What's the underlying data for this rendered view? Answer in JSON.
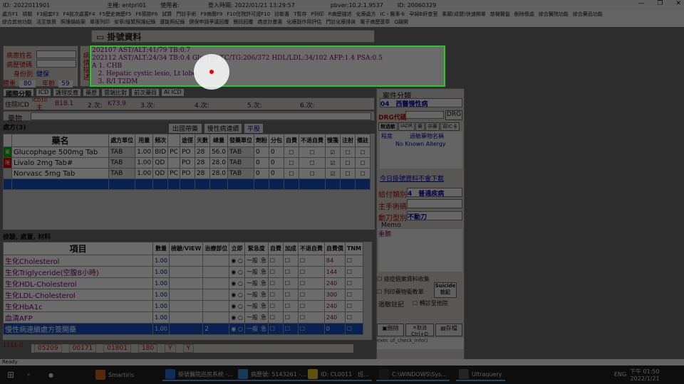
{
  "titlebar": {
    "id_label": "ID:",
    "id_value": "2022011901",
    "host_label": "主機: entpri01",
    "user_label": "使用者:",
    "login_time": "登入時間: 2022/01/21 13:29:57",
    "pbver": "pbver:10.2.1.9537",
    "id2": "ID: 20060329"
  },
  "menu": {
    "row1": [
      "處方F1",
      "檢驗",
      "F3組套F3",
      "F4前次處置F4",
      "F5歷史病歷F5",
      "F6預掛F6",
      "試算",
      "門診手術",
      "F9病曆F9",
      "F10住院許可證F10",
      "診斷書",
      "T暫存",
      "P列印",
      "R病歷描述",
      "化療處方",
      "IC・醫事卡",
      "孕婦B肝查室",
      "素願(成健)快速開單",
      "慈機醫盤",
      "刪除復處",
      "綜合醫院功能",
      "綜合藥品功能"
    ],
    "row2": [
      "綜合其他功能",
      "活至慈資",
      "照護錨結案",
      "單張列印",
      "安寧/緩緊照護紀錄",
      "還能照紀錄",
      "健保申請爭議回覆",
      "簡訊回覆",
      "癌症計畫書",
      "化療副作用評估",
      "門診化療排床",
      "電子病歷簽章",
      "Q離開"
    ]
  },
  "header_tab": "掛號資料",
  "patient": {
    "name_label": "病患姓名",
    "chart_label": "病歷號碼",
    "id_label": "身份別",
    "id_value": "健保",
    "age_label": "年齡",
    "age_value": "59",
    "weight_label": "體重",
    "weight_value": "80"
  },
  "history": {
    "vertical_label": "病情描述",
    "lines": [
      "202107 AST/ALT:41/79 TB:0.7",
      "202112 AST/ALT:24/34 TB:0.4 Glu:129 TC/TG:206/372 HDL/LDL:34/102 AFP:1.4 PSA:0.5",
      "A 1. CHB",
      "   2. Hepatic cystic lesio, Lt lobe",
      "   3. R/I T2DM"
    ]
  },
  "icd": {
    "tabs": [
      "國際分類",
      "ICD",
      "護理反應",
      "藥歷",
      "雲端比對",
      "前次藥目",
      "AI ICD"
    ],
    "main_label": "主",
    "main_code": "B18.1",
    "c2_label": "2.次:",
    "c2_code": "K73.9",
    "c3_label": "3.次:",
    "c4_label": "4.次:",
    "c5_label": "5.次:",
    "c6_label": "6.次:",
    "prefix": "住院ICD",
    "icd10": "ICD10"
  },
  "drug": {
    "label": "藥物"
  },
  "rx": {
    "title": "處方(3)",
    "buttons": [
      "出國帶藥",
      "慢性病連續",
      "平股"
    ],
    "headers": [
      "藥名",
      "處方單位",
      "用量",
      "頻次",
      "",
      "途徑",
      "天數",
      "總量",
      "發藥單位",
      "劑粉",
      "分包",
      "自費",
      "不退自費",
      "慢箋",
      "注射",
      "備註"
    ],
    "rows": [
      {
        "name": "Glucophage 500mg Tab",
        "unit": "TAB",
        "dose": "1.00",
        "freq": "BID",
        "pc": "PC",
        "route": "PO",
        "days": "28",
        "total": "56.0",
        "dunit": "TAB",
        "a": "0",
        "b": "0"
      },
      {
        "name": "Livalo 2mg Tab#",
        "unit": "TAB",
        "dose": "1.00",
        "freq": "QD",
        "pc": "",
        "route": "PO",
        "days": "28",
        "total": "28.0",
        "dunit": "TAB",
        "a": "0",
        "b": "0"
      },
      {
        "name": "Norvasc 5mg Tab",
        "unit": "TAB",
        "dose": "1.00",
        "freq": "QD",
        "pc": "PC",
        "route": "PO",
        "days": "28",
        "total": "28.0",
        "dunit": "TAB",
        "a": "0",
        "b": "0"
      }
    ]
  },
  "side": {
    "case_label": "案件分類",
    "case_value": "04　西醫慢性病",
    "drg_label": "DRG代碼",
    "drg_btn": "DRG",
    "subtabs": [
      "無過敏",
      "iADR",
      "藥",
      "非藥",
      "寫IC卡"
    ],
    "allergy_h1": "程度",
    "allergy_h2": "過敏藥物名稱",
    "allergy_value": "No Known Allergy",
    "today": "今日掛號資料不會下載",
    "pay_label": "給付類別",
    "pay_value": "4　普通疾病",
    "surg_label": "主手術碼",
    "op_label": "動刀型別",
    "op_value": "不動刀",
    "memo_label": "Memo",
    "memo_value": "重聽",
    "chk1": "癌症個案資料收集",
    "chk2": "列印藥物衛教單",
    "suicide": "Suicide 註記",
    "reg_label": "過敏註記",
    "transfer": "轉診至他院",
    "del_btn": "刪除",
    "cancel_btn": "取消 Ctrl+D",
    "save_btn": "存檔",
    "exec": "exec uf_check_info()"
  },
  "exam": {
    "title": "檢驗, 處置, 材料",
    "headers": [
      "項目",
      "數量",
      "檢驗/VIEW",
      "治療部位",
      "立即",
      "緊急度",
      "自費",
      "加成",
      "不退自費",
      "自費價",
      "TNM"
    ],
    "rows": [
      {
        "name": "生化Cholesterol",
        "qty": "1.00",
        "price": "84"
      },
      {
        "name": "生化Triglyceride(空腹8小時)",
        "qty": "1.00",
        "price": "144"
      },
      {
        "name": "生化HDL-Cholesterol",
        "qty": "1.00",
        "price": "240"
      },
      {
        "name": "生化LDL-Cholesterol",
        "qty": "1.00",
        "price": "300"
      },
      {
        "name": "生化HbA1c",
        "qty": "1.00",
        "price": "240"
      },
      {
        "name": "血清AFP",
        "qty": "1.00",
        "price": "240"
      }
    ],
    "selected": {
      "name": "慢性病連續處方簽開藥",
      "qty": "1.00",
      "site": "2",
      "price": "0"
    },
    "urgency": "一般",
    "urgency2": "急"
  },
  "footer_codes": [
    "05209",
    "00171",
    "01801",
    "180",
    "Y",
    "Y"
  ],
  "footer_left": "1111-0",
  "statusbar": "Ready",
  "taskbar": {
    "items": [
      "Smartiris",
      "掛號醫院巡房系統 -...",
      "病歷號: 5143261 -...",
      "ID: CL0011　班...",
      "C:\\WINDOWS\\Sys...",
      "Ultraquery"
    ],
    "lang": "ENG",
    "time": "下午 01:50",
    "date": "2022/1/21"
  }
}
